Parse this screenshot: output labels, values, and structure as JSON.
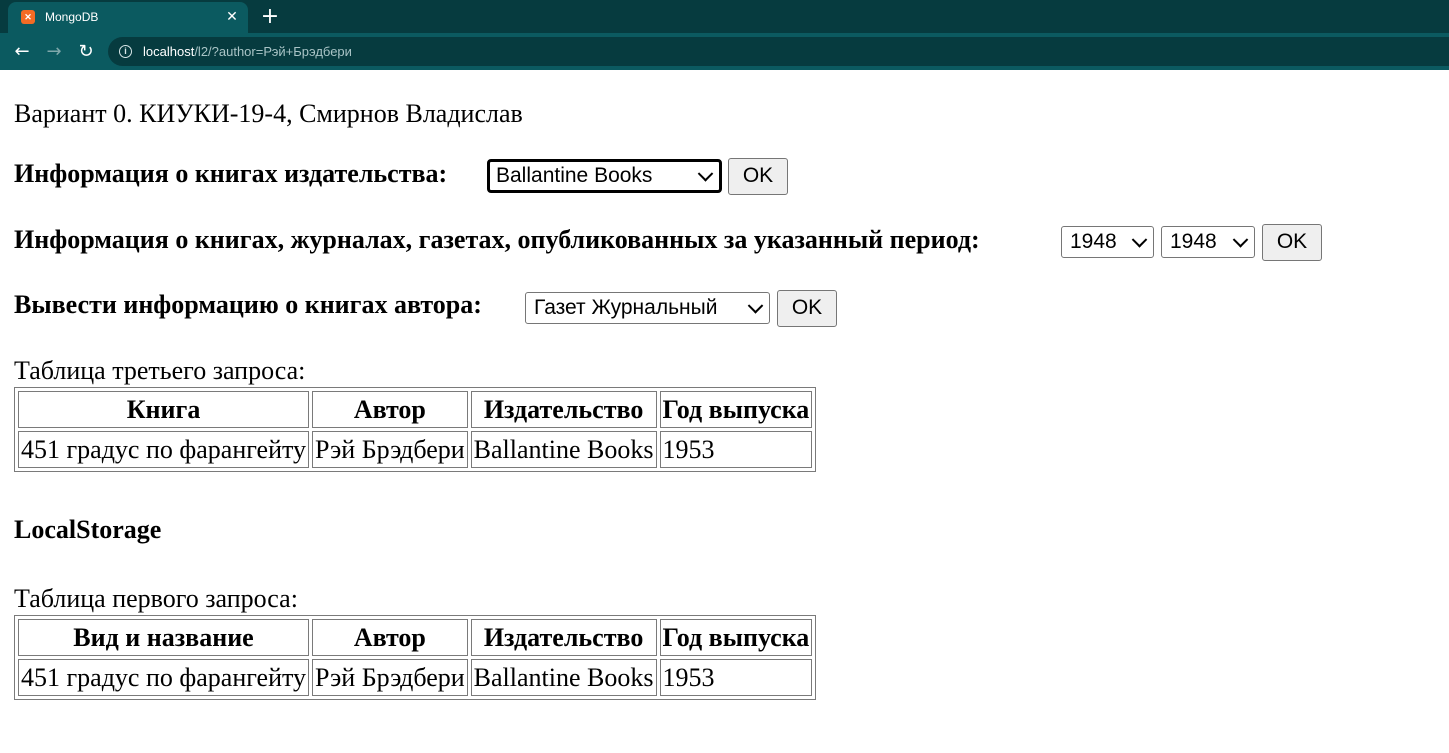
{
  "browser": {
    "tab_title": "MongoDB",
    "url_host": "localhost",
    "url_rest": "/l2/?author=Рэй+Брэдбери",
    "icons": {
      "favicon": "xampp-favicon-icon",
      "close": "close-icon",
      "new_tab": "plus-icon",
      "back": "arrow-left-icon",
      "forward": "arrow-right-icon",
      "reload": "reload-icon",
      "site_info": "info-icon"
    },
    "colors": {
      "tabbar": "#063b3f",
      "toolbar": "#0b5a60",
      "favicon": "#f36b24"
    }
  },
  "page": {
    "variant_title": "Вариант 0. КИУКИ-19-4, Смирнов Владислав",
    "publisher_form": {
      "label": "Информация о книгах издательства:",
      "selected": "Ballantine Books",
      "button": "OK"
    },
    "period_form": {
      "label": "Информация о книгах, журналах, газетах, опубликованных за указанный период:",
      "from_selected": "1948",
      "to_selected": "1948",
      "button": "OK"
    },
    "author_form": {
      "label": "Вывести информацию о книгах автора:",
      "selected": "Газет Журнальный",
      "button": "OK"
    },
    "third_query": {
      "caption": "Таблица третьего запроса:",
      "headers": [
        "Книга",
        "Автор",
        "Издательство",
        "Год выпуска"
      ],
      "rows": [
        [
          "451 градус по фарангейту",
          "Рэй Брэдбери",
          "Ballantine Books",
          "1953"
        ]
      ]
    },
    "local_storage_heading": "LocalStorage",
    "first_query": {
      "caption": "Таблица первого запроса:",
      "headers": [
        "Вид и название",
        "Автор",
        "Издательство",
        "Год выпуска"
      ],
      "rows": [
        [
          "451 градус по фарангейту",
          "Рэй Брэдбери",
          "Ballantine Books",
          "1953"
        ]
      ]
    }
  }
}
